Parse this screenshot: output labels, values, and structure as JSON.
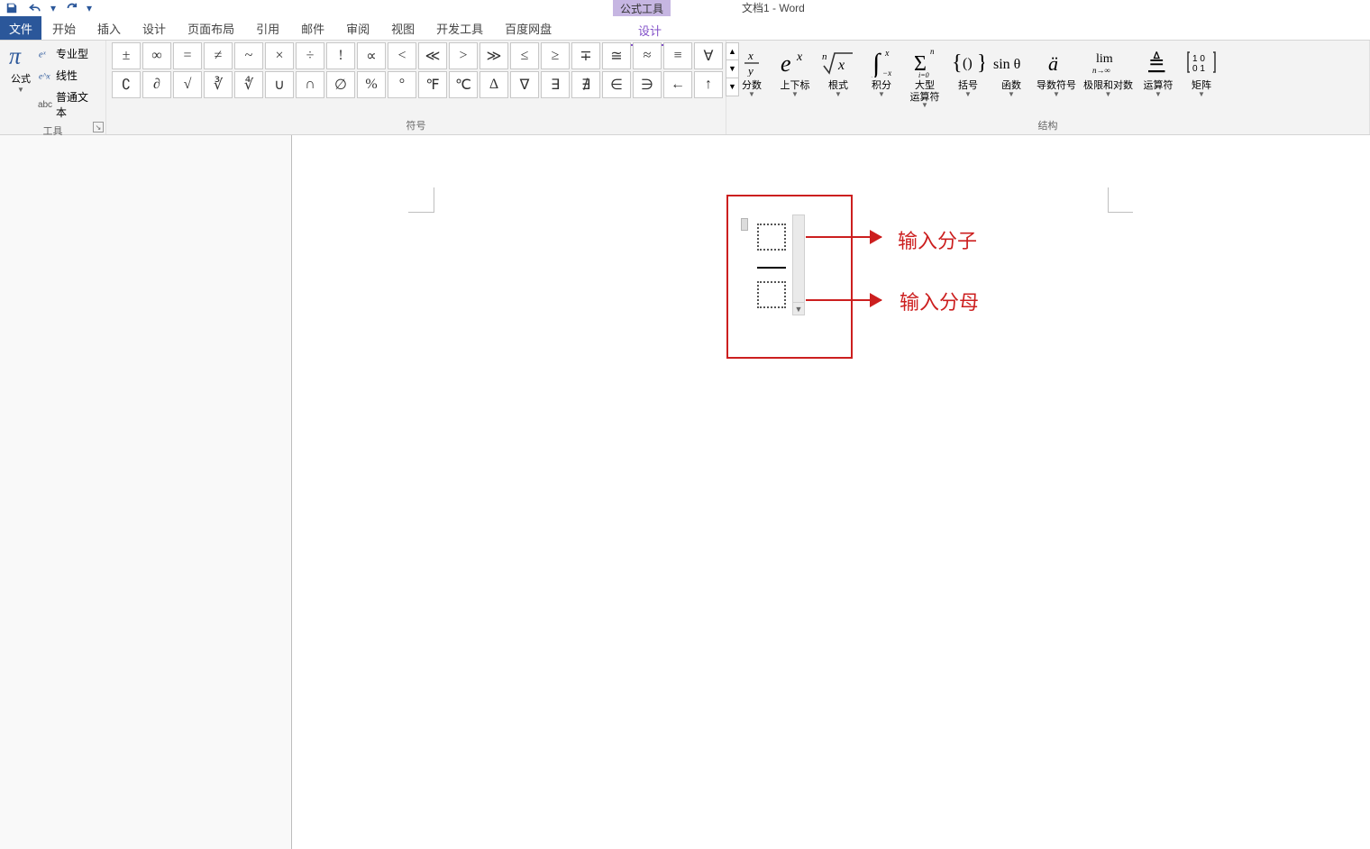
{
  "app": {
    "context_tab": "公式工具",
    "doc_title": "文档1 - Word"
  },
  "tabs": {
    "file": "文件",
    "items": [
      "开始",
      "插入",
      "设计",
      "页面布局",
      "引用",
      "邮件",
      "审阅",
      "视图",
      "开发工具",
      "百度网盘"
    ],
    "context_design": "设计"
  },
  "ribbon": {
    "tools": {
      "formula": "公式",
      "pro": "专业型",
      "linear": "线性",
      "plain": "普通文本",
      "group_label": "工具"
    },
    "symbols": {
      "group_label": "符号",
      "row1": [
        "±",
        "∞",
        "=",
        "≠",
        "~",
        "×",
        "÷",
        "!",
        "∝",
        "<",
        "≪",
        ">",
        "≫",
        "≤",
        "≥",
        "∓",
        "≅",
        "≈",
        "≡",
        "∀"
      ],
      "row2": [
        "∁",
        "∂",
        "√",
        "∛",
        "∜",
        "∪",
        "∩",
        "∅",
        "%",
        "°",
        "℉",
        "℃",
        "∆",
        "∇",
        "∃",
        "∄",
        "∈",
        "∋",
        "←",
        "↑"
      ]
    },
    "structures": {
      "group_label": "结构",
      "items": [
        {
          "key": "fraction",
          "label": "分数"
        },
        {
          "key": "script",
          "label": "上下标"
        },
        {
          "key": "radical",
          "label": "根式"
        },
        {
          "key": "integral",
          "label": "积分"
        },
        {
          "key": "large_op",
          "label": "大型\n运算符"
        },
        {
          "key": "bracket",
          "label": "括号"
        },
        {
          "key": "function",
          "label": "函数"
        },
        {
          "key": "accent",
          "label": "导数符号"
        },
        {
          "key": "limit_log",
          "label": "极限和对数"
        },
        {
          "key": "operator",
          "label": "运算符"
        },
        {
          "key": "matrix",
          "label": "矩阵"
        }
      ]
    }
  },
  "callouts": {
    "numerator": "输入分子",
    "denominator": "输入分母"
  }
}
